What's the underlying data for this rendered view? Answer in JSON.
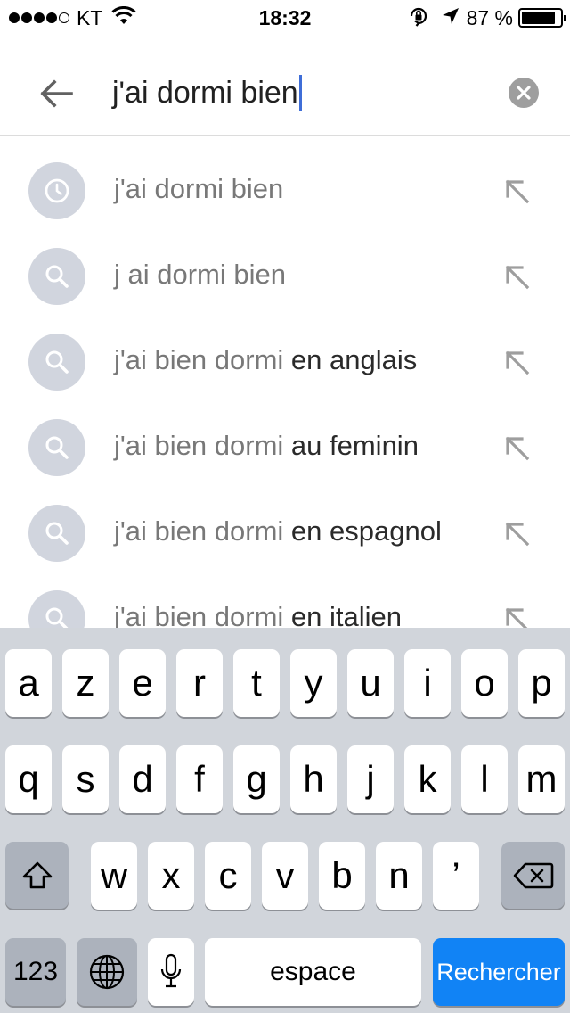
{
  "status_bar": {
    "carrier": "KT",
    "time": "18:32",
    "battery_percent": "87 %",
    "battery_level": 0.87,
    "signal_bars": 4,
    "signal_total": 5
  },
  "search": {
    "query": "j'ai dormi bien",
    "back_icon": "arrow-left-icon",
    "clear_icon": "clear-circle-icon"
  },
  "suggestions": [
    {
      "type": "history",
      "icon": "clock-icon",
      "query": "j'ai dormi bien",
      "rest": ""
    },
    {
      "type": "search",
      "icon": "search-icon",
      "query": "j ai dormi bien",
      "rest": ""
    },
    {
      "type": "search",
      "icon": "search-icon",
      "query": "j'ai bien dormi",
      "rest": " en anglais"
    },
    {
      "type": "search",
      "icon": "search-icon",
      "query": "j'ai bien dormi",
      "rest": " au feminin"
    },
    {
      "type": "search",
      "icon": "search-icon",
      "query": "j'ai bien dormi",
      "rest": " en espagnol"
    },
    {
      "type": "search",
      "icon": "search-icon",
      "query": "j'ai bien dormi",
      "rest": " en italien"
    }
  ],
  "keyboard": {
    "row1": [
      "a",
      "z",
      "e",
      "r",
      "t",
      "y",
      "u",
      "i",
      "o",
      "p"
    ],
    "row2": [
      "q",
      "s",
      "d",
      "f",
      "g",
      "h",
      "j",
      "k",
      "l",
      "m"
    ],
    "row3": [
      "w",
      "x",
      "c",
      "v",
      "b",
      "n",
      "’"
    ],
    "numbers_label": "123",
    "space_label": "espace",
    "return_label": "Rechercher",
    "accent_color": "#1183f5"
  }
}
